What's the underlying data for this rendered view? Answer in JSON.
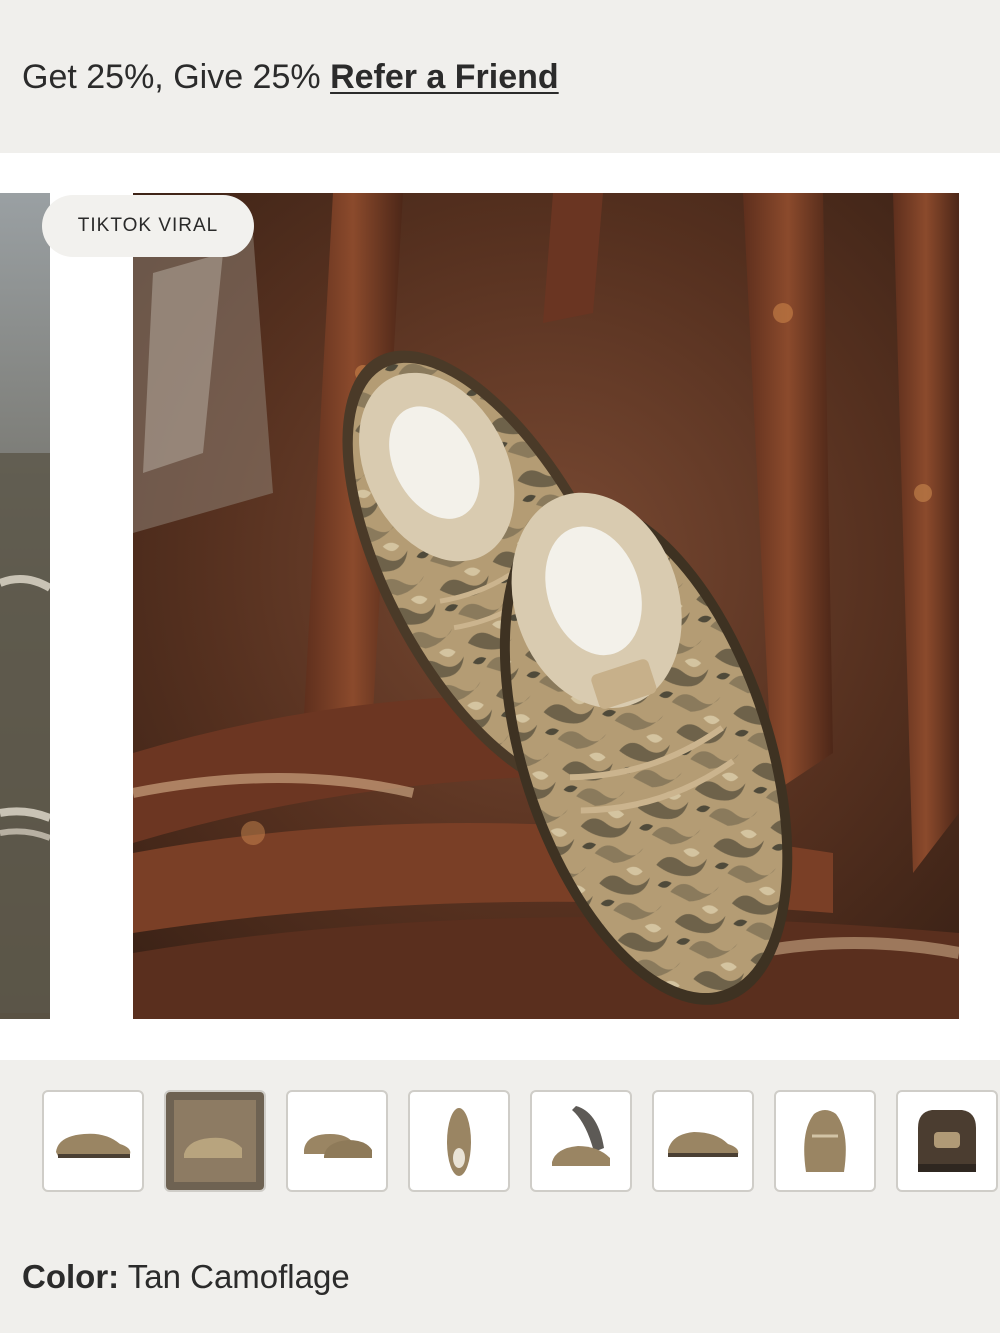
{
  "promo": {
    "text": "Get 25%, Give 25%",
    "link_label": "Refer a Friend"
  },
  "gallery": {
    "badge": "TIKTOK VIRAL",
    "image_icon": "shoe-photo-icon"
  },
  "thumbnails": [
    {
      "icon": "shoe-side-view-icon"
    },
    {
      "icon": "shoe-lifestyle-icon"
    },
    {
      "icon": "shoe-pair-icon"
    },
    {
      "icon": "shoe-top-view-icon"
    },
    {
      "icon": "shoe-sole-view-icon"
    },
    {
      "icon": "shoe-side-view-icon"
    },
    {
      "icon": "shoe-front-view-icon"
    },
    {
      "icon": "shoe-back-view-icon"
    }
  ],
  "product": {
    "color_label": "Color:",
    "color_value": "Tan Camoflage"
  },
  "colors": {
    "promo_bg": "#f0efec",
    "rust": "#6b3a26",
    "camo": "#a08a68"
  }
}
